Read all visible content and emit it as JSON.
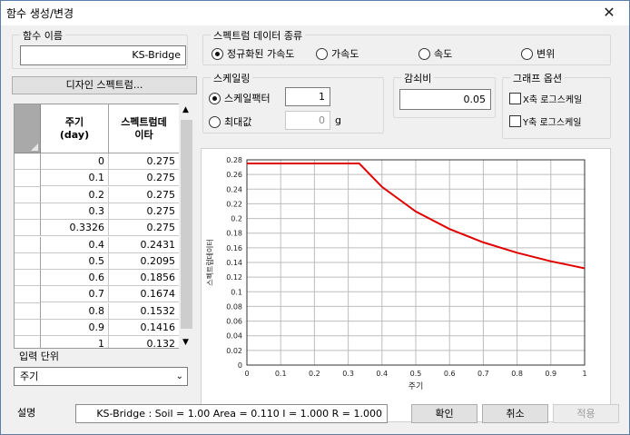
{
  "window": {
    "title": "함수 생성/변경",
    "close_glyph": "✕"
  },
  "function_name": {
    "label": "함수 이름",
    "value": "KS-Bridge"
  },
  "design_spectrum_button": "디자인 스펙트럼...",
  "spectrum_type": {
    "label": "스펙트럼 데이터 종류",
    "options": [
      "정규화된 가속도",
      "가속도",
      "속도",
      "변위"
    ],
    "selected": "정규화된 가속도"
  },
  "scaling": {
    "label": "스케일링",
    "scale_factor_label": "스케일팩터",
    "scale_factor_value": "1",
    "max_value_label": "최대값",
    "max_value_value": "0",
    "max_value_unit": "g",
    "selected": "스케일팩터"
  },
  "damping": {
    "label": "감쇠비",
    "value": "0.05"
  },
  "graph_options": {
    "label": "그래프 옵션",
    "x_log_label": "X축 로그스케일",
    "y_log_label": "Y축 로그스케일",
    "x_log_checked": false,
    "y_log_checked": false
  },
  "table": {
    "col_period": "주기\n(day)",
    "col_spectrum": "스펙트럼데\n이타",
    "new_row_marker": "+",
    "rows": [
      [
        "0",
        "0.275"
      ],
      [
        "0.1",
        "0.275"
      ],
      [
        "0.2",
        "0.275"
      ],
      [
        "0.3",
        "0.275"
      ],
      [
        "0.3326",
        "0.275"
      ],
      [
        "0.4",
        "0.2431"
      ],
      [
        "0.5",
        "0.2095"
      ],
      [
        "0.6",
        "0.1856"
      ],
      [
        "0.7",
        "0.1674"
      ],
      [
        "0.8",
        "0.1532"
      ],
      [
        "0.9",
        "0.1416"
      ],
      [
        "1",
        "0.132"
      ]
    ]
  },
  "input_unit": {
    "label": "입력 단위",
    "value": "주기"
  },
  "chart_data": {
    "type": "line",
    "x": [
      0,
      0.1,
      0.2,
      0.3,
      0.3326,
      0.4,
      0.5,
      0.6,
      0.7,
      0.8,
      0.9,
      1
    ],
    "series": [
      {
        "values": [
          0.275,
          0.275,
          0.275,
          0.275,
          0.275,
          0.2431,
          0.2095,
          0.1856,
          0.1674,
          0.1532,
          0.1416,
          0.132
        ],
        "color": "#e00000"
      }
    ],
    "xlabel": "주기",
    "ylabel": "스펙트럼데이터",
    "xlim": [
      0,
      1
    ],
    "ylim": [
      0,
      0.28
    ],
    "xticks": [
      "0",
      "0.1",
      "0.2",
      "0.3",
      "0.4",
      "0.5",
      "0.6",
      "0.7",
      "0.8",
      "0.9",
      "1"
    ],
    "yticks": [
      "0",
      "0.02",
      "0.04",
      "0.06",
      "0.08",
      "0.1",
      "0.12",
      "0.14",
      "0.16",
      "0.18",
      "0.2",
      "0.22",
      "0.24",
      "0.26",
      "0.28"
    ],
    "grid": true
  },
  "description": {
    "label": "설명",
    "value": "KS-Bridge : Soil = 1.00 Area = 0.110 I = 1.000 R = 1.000"
  },
  "buttons": {
    "ok": "확인",
    "cancel": "취소",
    "apply": "적용"
  }
}
